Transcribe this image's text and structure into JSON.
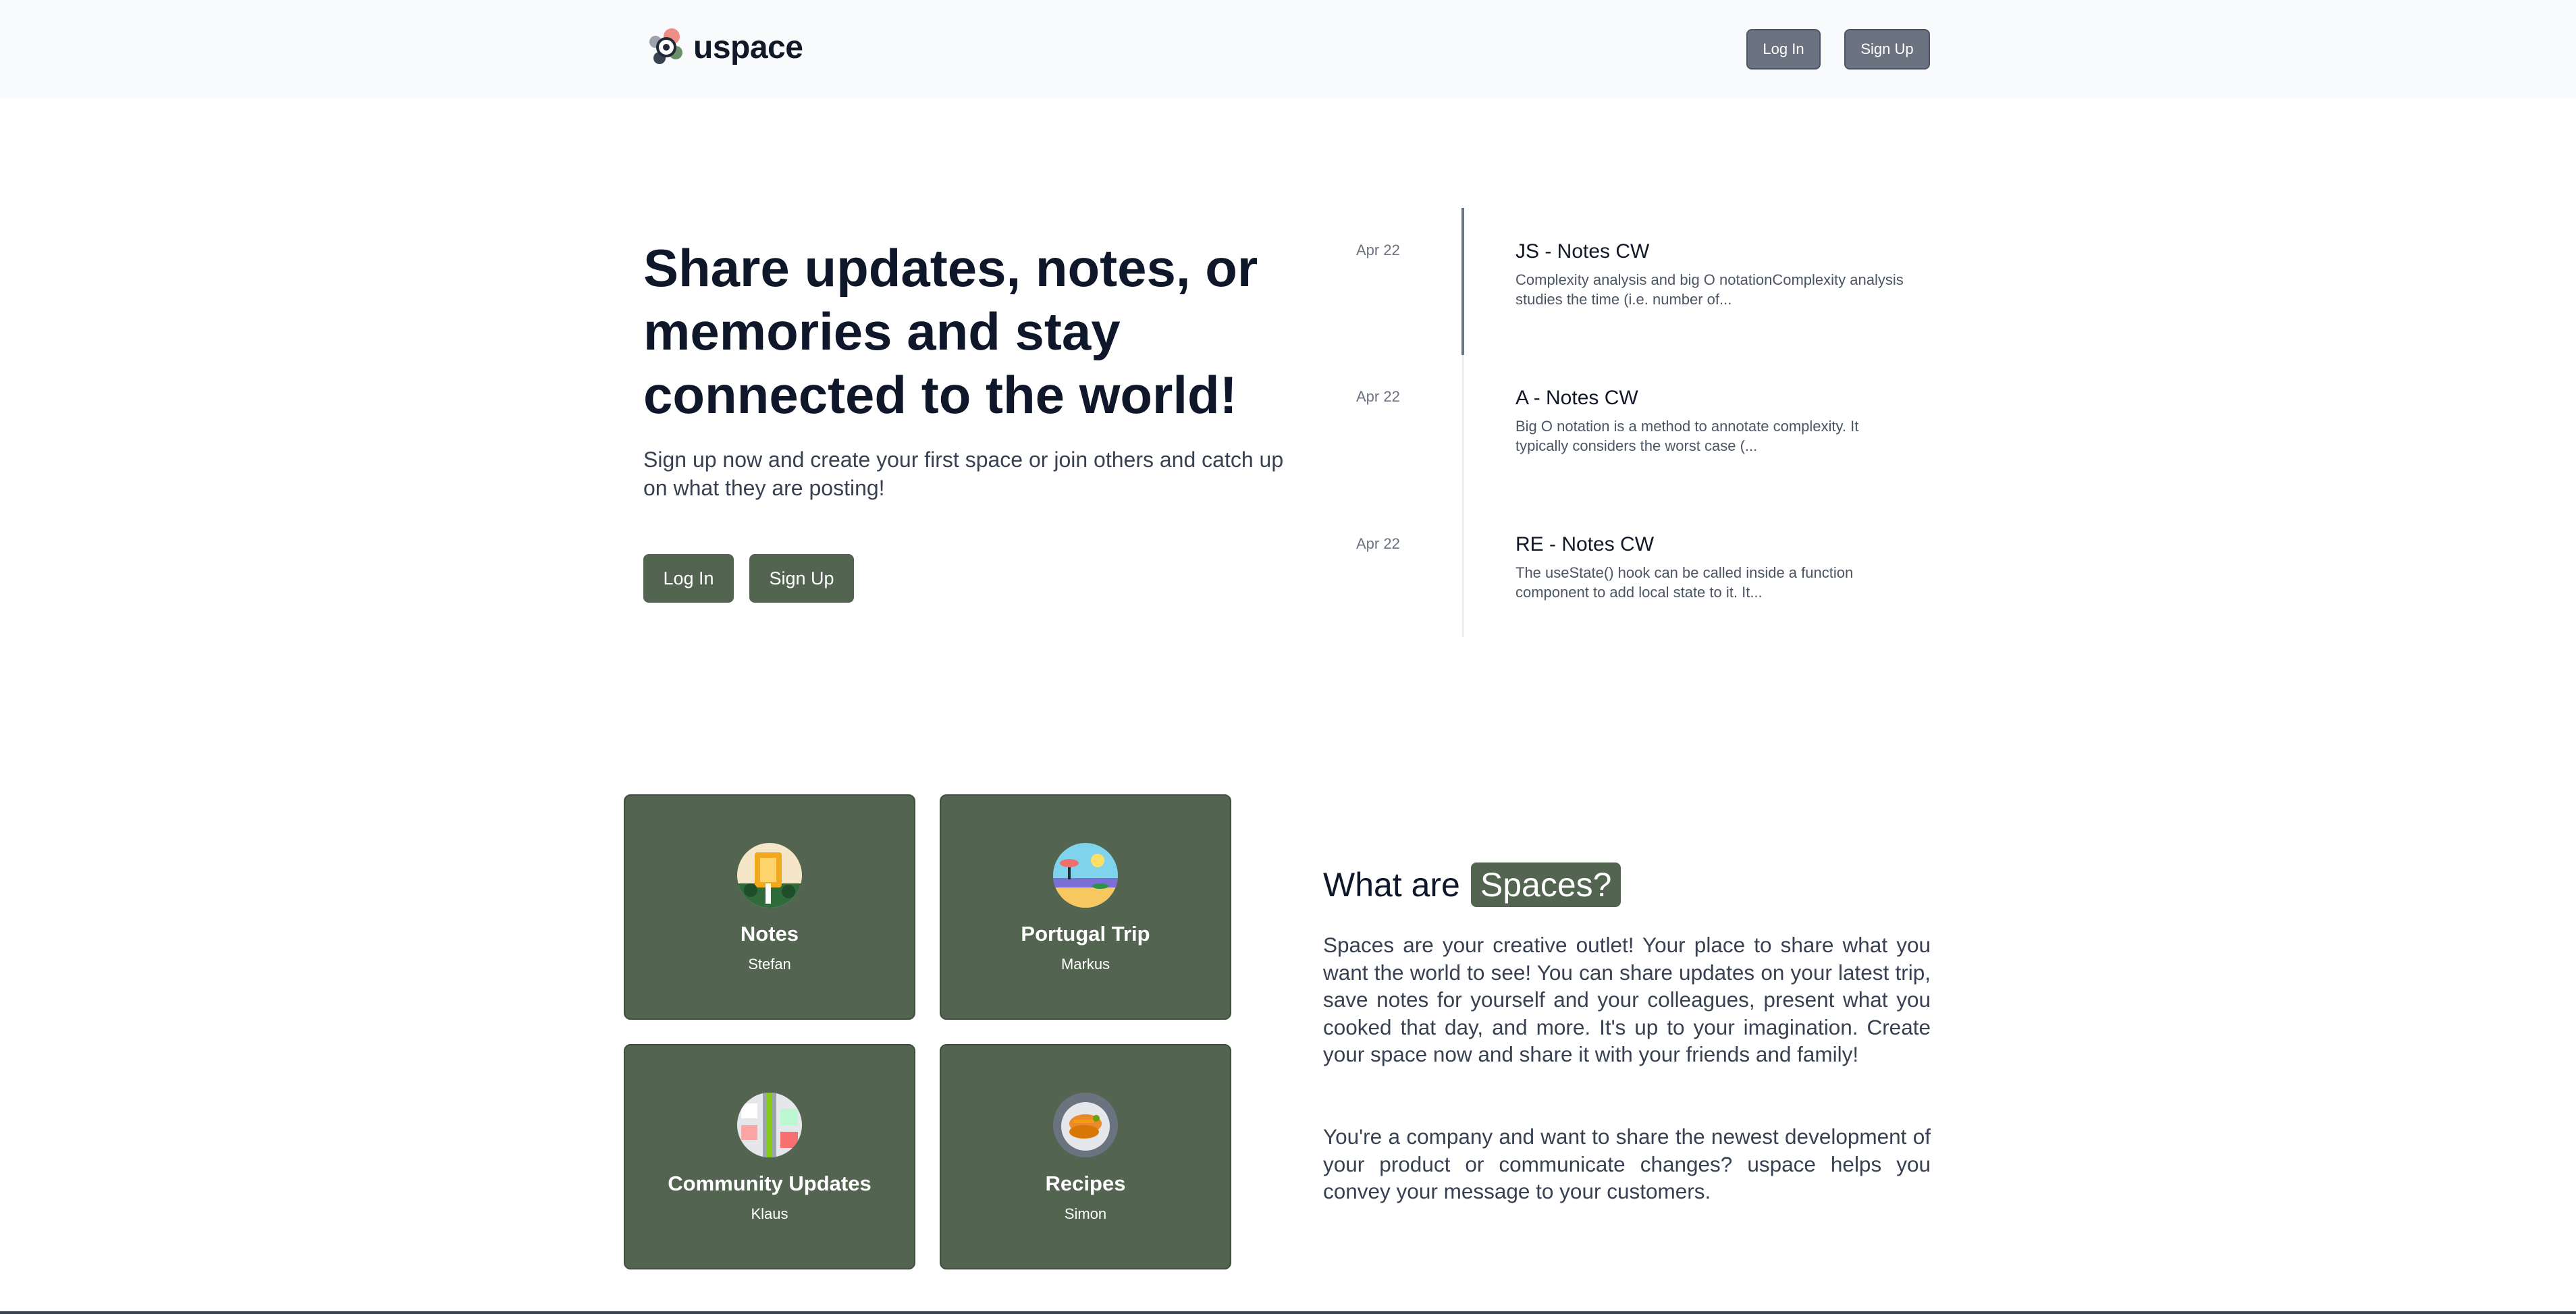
{
  "header": {
    "logo_text": "uspace",
    "login_label": "Log In",
    "signup_label": "Sign Up"
  },
  "hero": {
    "title": "Share updates, notes, or memories and stay connected to the world!",
    "subtitle": "Sign up now and create your first space or join others and catch up on what they are posting!",
    "login_label": "Log In",
    "signup_label": "Sign Up"
  },
  "timeline": [
    {
      "date": "Apr 22",
      "title": "JS - Notes CW",
      "excerpt": "Complexity analysis and big O notationComplexity analysis studies the time (i.e. number of..."
    },
    {
      "date": "Apr 22",
      "title": "A - Notes CW",
      "excerpt": "Big O notation is a method to annotate complexity. It typically considers the worst case (..."
    },
    {
      "date": "Apr 22",
      "title": "RE - Notes CW",
      "excerpt": "The useState() hook can be called inside a function component to add local state to it. It..."
    }
  ],
  "spaces_cards": [
    {
      "title": "Notes",
      "owner": "Stefan"
    },
    {
      "title": "Portugal Trip",
      "owner": "Markus"
    },
    {
      "title": "Community Updates",
      "owner": "Klaus"
    },
    {
      "title": "Recipes",
      "owner": "Simon"
    }
  ],
  "spaces_info": {
    "heading": "What are",
    "heading_badge": "Spaces?",
    "paragraph1": "Spaces are your creative outlet! Your place to share what you want the world to see! You can share updates on your latest trip, save notes for yourself and your colleagues, present what you cooked that day, and more. It's up to your imagination. Create your space now and share it with your friends and family!",
    "paragraph2": "You're a company and want to share the newest development of your product or communicate changes? uspace helps you convey your message to your customers."
  },
  "colors": {
    "accent_green": "#536451",
    "header_button_gray": "#6b7280",
    "header_bg": "#f9fafb"
  }
}
